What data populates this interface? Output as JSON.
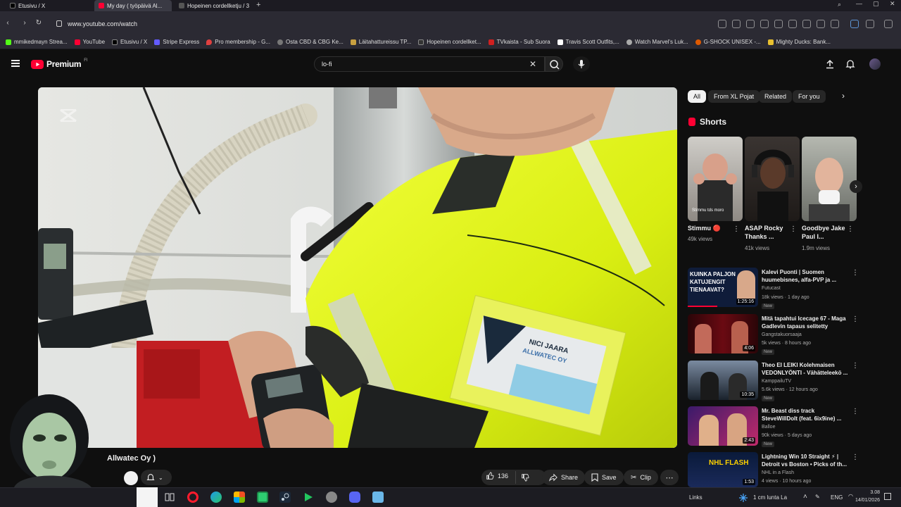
{
  "browser": {
    "tabs": [
      {
        "label": "Etusivu / X"
      },
      {
        "label": "My day ( työpäivä Al..."
      },
      {
        "label": "Hopeinen cordellketju / 3"
      }
    ],
    "url": "www.youtube.com/watch",
    "bookmarks": [
      "mmikedmayn Strea...",
      "YouTube",
      "Etusivu / X",
      "Stripe Express",
      "Pro membership - G...",
      "Osta CBD & CBG Ke...",
      "Läitahattureissu TP...",
      "Hopeinen cordellket...",
      "TVkaista - Sub Suora",
      "Travis Scott Outfits,...",
      "Watch Marvel's Luk...",
      "G-SHOCK UNISEX -...",
      "Mighty Ducks: Bank..."
    ]
  },
  "youtube": {
    "logo_label": "Premium",
    "logo_region": "FI",
    "search_value": "lo-fi",
    "video_title_fragment": "Allwatec Oy )",
    "badge_text": "NICI JAARA",
    "badge_company": "ALLWATEC OY",
    "likes": "136",
    "share_label": "Share",
    "save_label": "Save",
    "clip_label": "Clip"
  },
  "chips": [
    {
      "label": "All"
    },
    {
      "label": "From XL Pojat"
    },
    {
      "label": "Related"
    },
    {
      "label": "For you"
    }
  ],
  "shorts": {
    "heading": "Shorts",
    "items": [
      {
        "title": "Stimmu 🔴",
        "views": "49k views",
        "overlay": "Stimmu tds moro"
      },
      {
        "title": "ASAP Rocky Thanks ...",
        "views": "41k views"
      },
      {
        "title": "Goodbye Jake Paul I...",
        "views": "1.9m views"
      }
    ]
  },
  "videos": [
    {
      "title": "Kalevi Puonti | Suomen huumebisnes, alfa-PVP ja ...",
      "channel": "Futucast",
      "meta": "18k views · 1 day ago",
      "badge": "New",
      "duration": "1:25:16",
      "thumb_text": "KUINKA PALJON KATUJENGIT TIENAAVAT?"
    },
    {
      "title": "Mitä tapahtui Icecage 67 - Maga Gadlevin tapaus selitetty",
      "channel": "Gangstakuorsaaja",
      "meta": "5k views · 8 hours ago",
      "badge": "New",
      "duration": "4:06"
    },
    {
      "title": "Theo EI LEIKI Kolehmaisen VEDONLYÖNTI - Vähätteleekö ...",
      "channel": "KamppailuTV",
      "meta": "5.6k views · 12 hours ago",
      "badge": "New",
      "duration": "10:35"
    },
    {
      "title": "Mr. Beast diss track SteveWillDoIt (feat. 6ix9ine) ...",
      "channel": "Balloe",
      "meta": "90k views · 5 days ago",
      "badge": "New",
      "duration": "2:43"
    },
    {
      "title": "Lightning Win 10 Straight ⚡ | Detroit vs Boston • Picks of th...",
      "channel": "NHL in a Flash",
      "meta": "4 views · 10 hours ago",
      "duration": "1:53",
      "thumb_text": "NHL FLASH"
    }
  ],
  "taskbar": {
    "links": "Links",
    "weather": "1 cm lunta La",
    "lang": "ENG",
    "time": "3.08",
    "date": "14/01/2026"
  },
  "colors": {
    "youtube_red": "#ff0033",
    "hi_vis_yellow": "#e2f21a",
    "page_bg": "#0f0f0f"
  }
}
